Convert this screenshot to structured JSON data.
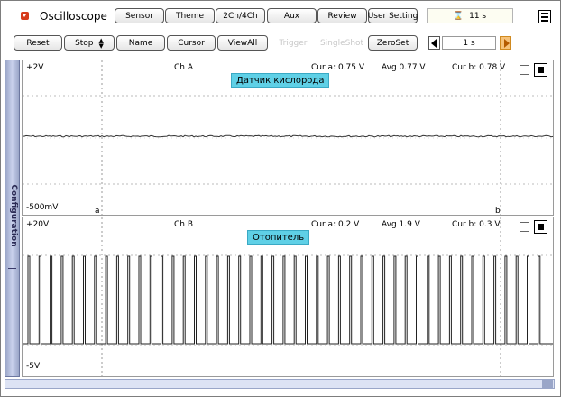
{
  "app": {
    "title": "Oscilloscope"
  },
  "toolbar1": [
    "Sensor",
    "Theme",
    "2Ch/4Ch",
    "Aux",
    "Review",
    "User Setting"
  ],
  "timer": "11 s",
  "toolbar2": {
    "reset": "Reset",
    "stop": "Stop",
    "name": "Name",
    "cursor": "Cursor",
    "viewall": "ViewAll",
    "trigger": "Trigger",
    "singleshot": "SingleShot",
    "zeroset": "ZeroSet",
    "timebase": "1 s"
  },
  "sidebar_label": "Configuration",
  "channel_a": {
    "top": "+2V",
    "bottom": "-500mV",
    "name": "Ch A",
    "cur_a": "Cur a: 0.75 V",
    "avg": "Avg   0.77 V",
    "cur_b": "Cur b: 0.78 V",
    "label": "Датчик кислорода",
    "cursor_a": "a",
    "cursor_b": "b"
  },
  "channel_b": {
    "top": "+20V",
    "bottom": "-5V",
    "name": "Ch B",
    "cur_a": "Cur a: 0.2 V",
    "avg": "Avg   1.9 V",
    "cur_b": "Cur b: 0.3 V",
    "label": "Отопитель"
  },
  "colors": {
    "trace": "#1e1e1e",
    "label_bg": "#5fd0e6",
    "grid": "#b0b0b0",
    "sidebar": "#9aa6c8"
  }
}
